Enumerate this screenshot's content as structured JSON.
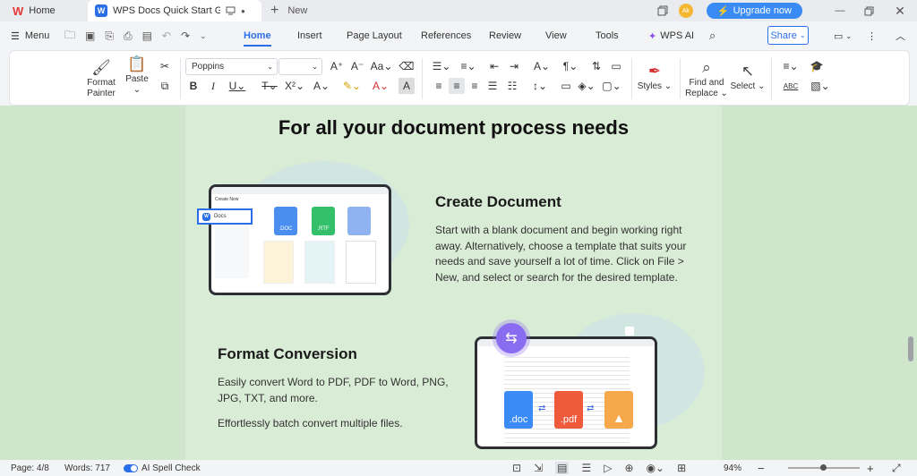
{
  "titlebar": {
    "home_tab": "Home",
    "doc_tab": "WPS Docs Quick Start Guide.d",
    "new_tab": "New",
    "avatar_initials": "Ak",
    "upgrade_label": "Upgrade now"
  },
  "menubar": {
    "menu_label": "Menu",
    "tabs": [
      "Home",
      "Insert",
      "Page Layout",
      "References",
      "Review",
      "View",
      "Tools"
    ],
    "wps_ai": "WPS AI",
    "share": "Share"
  },
  "ribbon": {
    "format_painter": "Format Painter",
    "paste": "Paste",
    "font_name": "Poppins",
    "font_size": "",
    "styles": "Styles",
    "find_replace_1": "Find and",
    "find_replace_2": "Replace",
    "select": "Select",
    "abc": "ABC"
  },
  "document": {
    "heading": "For all your document process needs",
    "section1_title": "Create Document",
    "section1_text": "Start with a blank document and begin working right away. Alternatively, choose a template that suits your needs and save yourself a lot of time. Click on File > New, and select or search for the desired template.",
    "section2_title": "Format Conversion",
    "section2_text1": "Easily convert Word to PDF, PDF to Word, PNG, JPG, TXT, and more.",
    "section2_text2": "Effortlessly batch convert multiple files.",
    "mock_docs_label": "Docs",
    "mock_create_new": "Create New",
    "doc_label": ".doc",
    "pdf_label": ".pdf",
    "mock_small_doc": ".DOC",
    "mock_small_rtf": ".RTF"
  },
  "statusbar": {
    "page": "Page: 4/8",
    "words": "Words: 717",
    "spell_check": "AI Spell Check",
    "zoom": "94%"
  },
  "colors": {
    "accent": "#2a6ee8",
    "page_bg": "#d9ecd5",
    "canvas_bg": "#cfe6cc",
    "upgrade": "#3a8bf5"
  }
}
